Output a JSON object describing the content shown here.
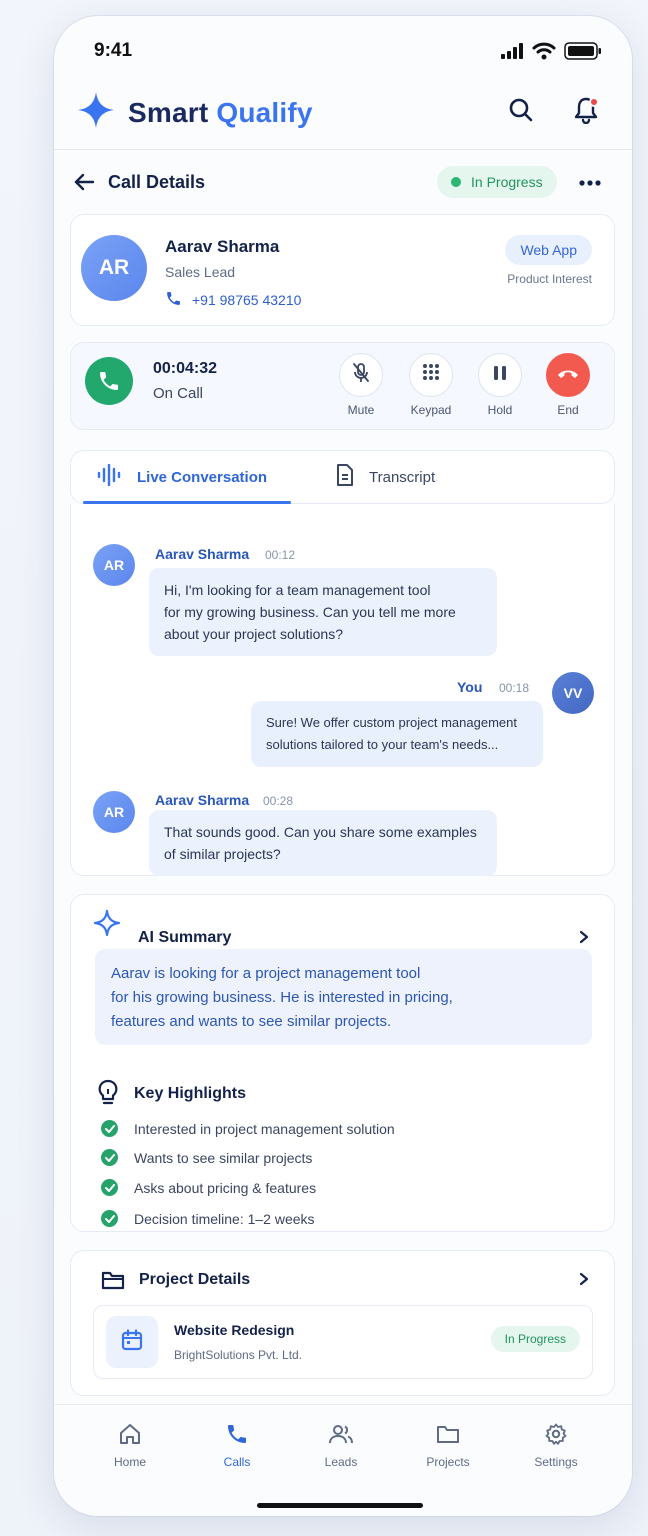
{
  "status_bar": {
    "time": "9:41"
  },
  "app": {
    "title_main": "Smart",
    "title_accent": "Qualify"
  },
  "page": {
    "title": "Call Details",
    "status": "In Progress"
  },
  "contact": {
    "initials": "AR",
    "name": "Aarav Sharma",
    "role": "Sales Lead",
    "phone": "+91 98765 43210",
    "interest": "Web App",
    "interest_label": "Product Interest"
  },
  "call": {
    "timer": "00:04:32",
    "state": "On Call",
    "controls": {
      "mute": "Mute",
      "keypad": "Keypad",
      "hold": "Hold",
      "end": "End"
    }
  },
  "tabs": {
    "live": "Live Conversation",
    "transcript": "Transcript"
  },
  "messages": [
    {
      "initials": "AR",
      "name": "Aarav Sharma",
      "time": "00:12",
      "line1": "Hi, I'm looking for a team management tool",
      "line2": "for my growing business. Can you tell me more",
      "line3": "about your project solutions?"
    },
    {
      "initials": "VV",
      "name": "You",
      "time": "00:18",
      "line1": "Sure! We offer custom project management",
      "line2": "solutions tailored to your team's needs..."
    },
    {
      "initials": "AR",
      "name": "Aarav Sharma",
      "time": "00:28",
      "line1": "That sounds good. Can you share some examples",
      "line2": "of similar projects?"
    }
  ],
  "summary": {
    "title": "AI Summary",
    "line1": "Aarav is looking for a project management tool",
    "line2": "for his growing business. He is interested in pricing,",
    "line3": "features and wants to see similar projects.",
    "highlights_title": "Key Highlights",
    "highlights": [
      "Interested in project management solution",
      "Wants to see similar projects",
      "Asks about pricing & features",
      "Decision timeline: 1–2 weeks"
    ]
  },
  "project": {
    "section_title": "Project Details",
    "name": "Website Redesign",
    "company": "BrightSolutions Pvt. Ltd.",
    "status": "In Progress"
  },
  "nav": {
    "home": "Home",
    "calls": "Calls",
    "leads": "Leads",
    "projects": "Projects",
    "settings": "Settings"
  },
  "icons": [
    "sparkle-icon",
    "search-icon",
    "bell-icon",
    "back-arrow-icon",
    "more-icon",
    "phone-icon",
    "mic-off-icon",
    "keypad-icon",
    "pause-icon",
    "end-call-icon",
    "waveform-icon",
    "document-icon",
    "chevron-right-icon",
    "lightbulb-icon",
    "check-icon",
    "folder-icon",
    "calendar-icon",
    "home-icon",
    "users-icon",
    "settings-icon"
  ],
  "colors": {
    "brand": "#1b2a5e",
    "accent": "#3b74f0",
    "success": "#22a86c",
    "danger": "#f25a4f"
  }
}
